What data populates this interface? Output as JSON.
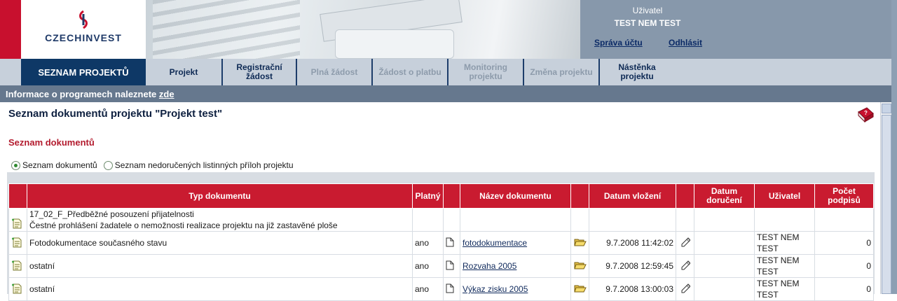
{
  "header": {
    "logo_text": "CZECHINVEST",
    "user_label": "Uživatel",
    "user_name": "TEST NEM TEST",
    "account_link": "Správa účtu",
    "logout_link": "Odhlásit"
  },
  "nav": {
    "main": "SEZNAM PROJEKTŮ",
    "tabs": [
      {
        "label": "Projekt",
        "enabled": true
      },
      {
        "label": "Registrační\nžádost",
        "enabled": true
      },
      {
        "label": "Plná žádost",
        "enabled": false
      },
      {
        "label": "Žádost o platbu",
        "enabled": false
      },
      {
        "label": "Monitoring\nprojektu",
        "enabled": false
      },
      {
        "label": "Změna projektu",
        "enabled": false
      },
      {
        "label": "Nástěnka\nprojektu",
        "enabled": true
      }
    ]
  },
  "info": {
    "text": "Informace o programech naleznete ",
    "link": "zde"
  },
  "page": {
    "title": "Seznam dokumentů projektu  \"Projekt test\"",
    "section_title": "Seznam dokumentů",
    "radio_1": "Seznam dokumentů",
    "radio_2": "Seznam nedoručených listinných příloh projektu"
  },
  "table": {
    "headers": {
      "type": "Typ dokumentu",
      "valid": "Platný",
      "name": "Název dokumentu",
      "date_inserted": "Datum vložení",
      "date_delivered": "Datum\ndoručení",
      "user": "Uživatel",
      "signatures": "Počet\npodpisů"
    },
    "group": {
      "line1": "17_02_F_Předběžné posouzení přijatelnosti",
      "line2": "Čestné prohlášení žadatele o nemožnosti realizace projektu na již zastavěné ploše"
    },
    "rows": [
      {
        "type": "Fotodokumentace současného stavu",
        "valid": "ano",
        "name": "fotodokumentace",
        "date": "9.7.2008 11:42:02",
        "user": "TEST NEM\nTEST",
        "signatures": "0"
      },
      {
        "type": "ostatní",
        "valid": "ano",
        "name": "Rozvaha 2005",
        "date": "9.7.2008 12:59:45",
        "user": "TEST NEM\nTEST",
        "signatures": "0"
      },
      {
        "type": "ostatní",
        "valid": "ano",
        "name": "Výkaz zisku 2005",
        "date": "9.7.2008 13:00:03",
        "user": "TEST NEM\nTEST",
        "signatures": "0"
      }
    ]
  }
}
